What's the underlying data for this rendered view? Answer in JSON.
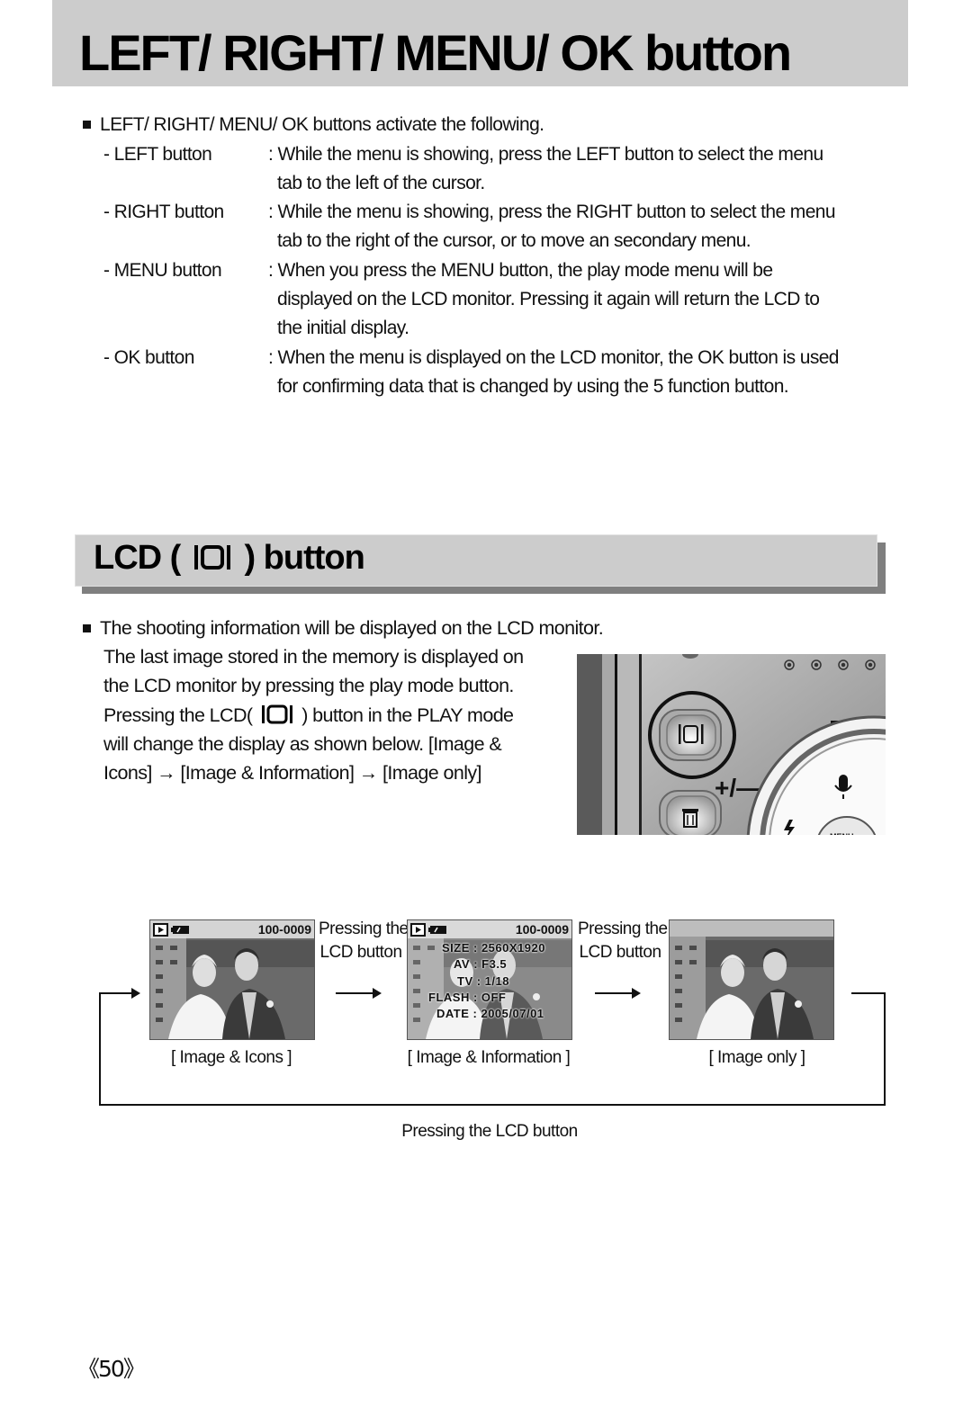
{
  "header": {
    "title": "LEFT/ RIGHT/ MENU/ OK button"
  },
  "section1": {
    "intro": "LEFT/ RIGHT/ MENU/ OK buttons activate the following.",
    "items": [
      {
        "label": "- LEFT button",
        "lines": [
          ": While the menu is showing, press the LEFT button to select the menu",
          "tab to the left of the cursor."
        ]
      },
      {
        "label": "- RIGHT button",
        "lines": [
          ": While the menu is showing, press the RIGHT button to select the menu",
          "tab to the right of the cursor, or to move an secondary menu."
        ]
      },
      {
        "label": "- MENU button",
        "lines": [
          ": When you press the MENU button, the play mode menu will be",
          "displayed on the LCD monitor. Pressing it again will return the LCD to",
          "the initial display."
        ]
      },
      {
        "label": "- OK button",
        "lines": [
          ": When the menu is displayed on the LCD monitor, the OK button is used",
          "for confirming data that is changed by using the 5 function button."
        ]
      }
    ]
  },
  "section2": {
    "title_prefix": "LCD (",
    "title_suffix": ") button",
    "title_icon": "lcd-display-icon",
    "paragraph": {
      "line1": "The shooting information will be displayed on the LCD monitor.",
      "line2": "The last image stored in the memory is displayed on",
      "line3": "the LCD monitor by pressing the play mode button.",
      "line4_a": "Pressing the LCD(",
      "line4_b": ") button in the PLAY mode",
      "line5": "will change the display as shown below. [Image &",
      "line6": "Icons] → [Image & Information] →  [Image only]"
    },
    "camera_photo": {
      "icons": [
        "lcd-button-icon",
        "delete-icon",
        "voice-memo-icon",
        "microphone-icon",
        "flash-icon",
        "menu-button-icon"
      ],
      "plus_minus": "+/—",
      "menu_label": "MENU"
    }
  },
  "diagram": {
    "screens": [
      {
        "caption": "[ Image & Icons ]",
        "file_no": "100-0009",
        "mode_icon": "play-icon",
        "battery_icon": "battery-icon",
        "info": []
      },
      {
        "caption": "[ Image & Information ]",
        "file_no": "100-0009",
        "mode_icon": "play-icon",
        "battery_icon": "battery-icon",
        "info": [
          "SIZE : 2560X1920",
          "AV : F3.5",
          "TV : 1/18",
          "FLASH : OFF",
          "DATE : 2005/07/01"
        ]
      },
      {
        "caption": "[ Image only ]",
        "info": []
      }
    ],
    "transition_label_1": "Pressing the",
    "transition_label_2": "LCD button",
    "loop_label": "Pressing the LCD button"
  },
  "footer": {
    "page_number": "《50》"
  }
}
